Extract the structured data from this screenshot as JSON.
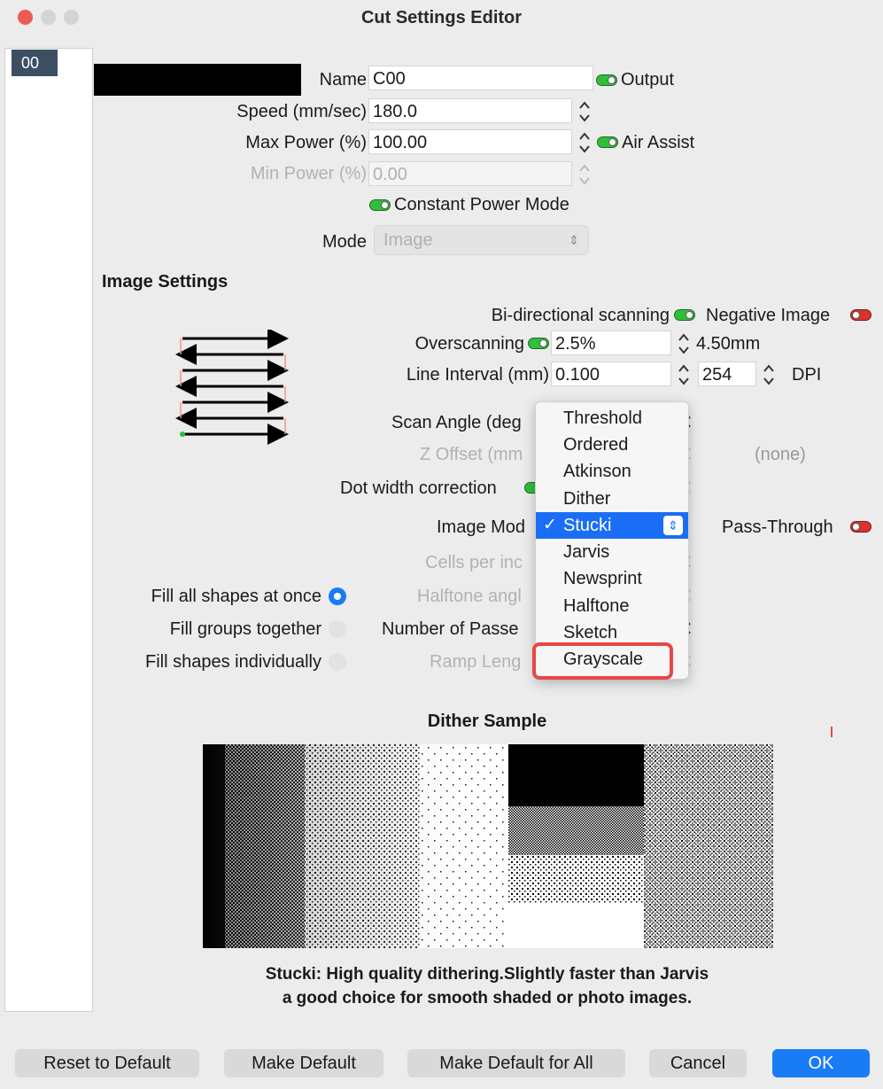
{
  "window": {
    "title": "Cut Settings Editor"
  },
  "layer_list": {
    "items": [
      "00"
    ]
  },
  "form": {
    "name_label": "Name",
    "name_value": "C00",
    "output_label": "Output",
    "speed_label": "Speed (mm/sec)",
    "speed_value": "180.0",
    "max_power_label": "Max Power (%)",
    "max_power_value": "100.00",
    "air_assist_label": "Air Assist",
    "min_power_label": "Min Power (%)",
    "min_power_value": "0.00",
    "constant_power_label": "Constant Power Mode",
    "mode_label": "Mode",
    "mode_value": "Image"
  },
  "image_settings": {
    "heading": "Image Settings",
    "bidirectional_label": "Bi-directional scanning",
    "negative_image_label": "Negative Image",
    "overscanning_label": "Overscanning",
    "overscanning_value": "2.5%",
    "overscanning_mm": "4.50mm",
    "line_interval_label": "Line Interval (mm)",
    "line_interval_value": "0.100",
    "dpi_value": "254",
    "dpi_label": "DPI",
    "scan_angle_label": "Scan Angle (deg",
    "z_offset_label": "Z Offset (mm",
    "z_offset_none": "(none)",
    "dot_width_label": "Dot width correction",
    "image_mode_label": "Image Mod",
    "pass_through_label": "Pass-Through",
    "cells_label": "Cells per inc",
    "halftone_angle_label": "Halftone angl",
    "passes_label": "Number of Passe",
    "ramp_label": "Ramp Leng",
    "fill_all_label": "Fill all shapes at once",
    "fill_groups_label": "Fill groups together",
    "fill_individual_label": "Fill shapes individually"
  },
  "image_mode_menu": {
    "items": [
      "Threshold",
      "Ordered",
      "Atkinson",
      "Dither",
      "Stucki",
      "Jarvis",
      "Newsprint",
      "Halftone",
      "Sketch",
      "Grayscale"
    ],
    "selected": "Stucki",
    "highlighted": "Grayscale",
    "check_mark": "✓"
  },
  "dither_sample": {
    "heading": "Dither Sample",
    "desc_line1": "Stucki: High quality dithering.Slightly faster than Jarvis",
    "desc_line2": "a good choice for smooth shaded or photo images."
  },
  "buttons": {
    "reset": "Reset to Default",
    "make_default": "Make Default",
    "make_default_all": "Make Default for All",
    "cancel": "Cancel",
    "ok": "OK"
  },
  "colors": {
    "accent": "#1a7cf5",
    "toggle_on": "#2fbf3a",
    "toggle_off": "#d8332d",
    "highlight_box": "#e54848"
  }
}
